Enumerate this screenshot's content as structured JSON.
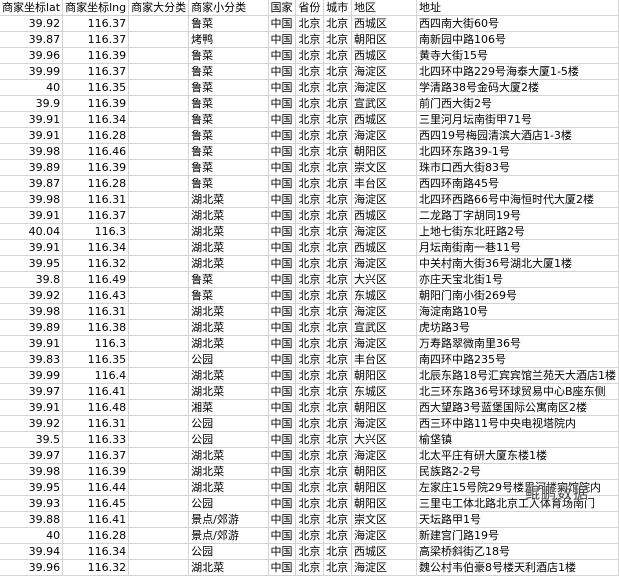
{
  "sheet": {
    "headers": [
      "商家坐标lat",
      "商家坐标lng",
      "商家大分类",
      "商家小分类",
      "国家",
      "省份",
      "城市",
      "地区",
      "地址"
    ],
    "rows": [
      [
        "39.92",
        "116.37",
        "",
        "鲁菜",
        "中国",
        "北京",
        "北京",
        "西城区",
        "西四南大街60号"
      ],
      [
        "39.87",
        "116.37",
        "",
        "烤鸭",
        "中国",
        "北京",
        "北京",
        "朝阳区",
        "南新园中路106号"
      ],
      [
        "39.96",
        "116.39",
        "",
        "鲁菜",
        "中国",
        "北京",
        "北京",
        "西城区",
        "黄寺大街15号"
      ],
      [
        "39.99",
        "116.37",
        "",
        "鲁菜",
        "中国",
        "北京",
        "北京",
        "海淀区",
        "北四环中路229号海泰大厦1-5楼"
      ],
      [
        "40",
        "116.35",
        "",
        "鲁菜",
        "中国",
        "北京",
        "北京",
        "海淀区",
        "学清路38号金码大厦2楼"
      ],
      [
        "39.9",
        "116.39",
        "",
        "鲁菜",
        "中国",
        "北京",
        "北京",
        "宣武区",
        "前门西大街2号"
      ],
      [
        "39.91",
        "116.34",
        "",
        "鲁菜",
        "中国",
        "北京",
        "北京",
        "西城区",
        "三里河月坛南街甲71号"
      ],
      [
        "39.91",
        "116.28",
        "",
        "鲁菜",
        "中国",
        "北京",
        "北京",
        "海淀区",
        "西四19号梅园清滨大酒店1-3楼"
      ],
      [
        "39.98",
        "116.46",
        "",
        "鲁菜",
        "中国",
        "北京",
        "北京",
        "朝阳区",
        "北四环东路39-1号"
      ],
      [
        "39.89",
        "116.39",
        "",
        "鲁菜",
        "中国",
        "北京",
        "北京",
        "崇文区",
        "珠市口西大街83号"
      ],
      [
        "39.87",
        "116.28",
        "",
        "鲁菜",
        "中国",
        "北京",
        "北京",
        "丰台区",
        "西四环南路45号"
      ],
      [
        "39.98",
        "116.31",
        "",
        "湖北菜",
        "中国",
        "北京",
        "北京",
        "海淀区",
        "北四环西路66号中海恒时代大厦2楼"
      ],
      [
        "39.91",
        "116.37",
        "",
        "湖北菜",
        "中国",
        "北京",
        "北京",
        "西城区",
        "二龙路丁字胡同19号"
      ],
      [
        "40.04",
        "116.3",
        "",
        "湖北菜",
        "中国",
        "北京",
        "北京",
        "海淀区",
        "上地七街东北旺路2号"
      ],
      [
        "39.91",
        "116.34",
        "",
        "湖北菜",
        "中国",
        "北京",
        "北京",
        "西城区",
        "月坛南街南一巷11号"
      ],
      [
        "39.95",
        "116.32",
        "",
        "湖北菜",
        "中国",
        "北京",
        "北京",
        "海淀区",
        "中关村南大街36号湖北大厦1楼"
      ],
      [
        "39.8",
        "116.49",
        "",
        "鲁菜",
        "中国",
        "北京",
        "北京",
        "大兴区",
        "亦庄天宝北街1号"
      ],
      [
        "39.92",
        "116.43",
        "",
        "鲁菜",
        "中国",
        "北京",
        "北京",
        "东城区",
        "朝阳门南小街269号"
      ],
      [
        "39.98",
        "116.31",
        "",
        "湖北菜",
        "中国",
        "北京",
        "北京",
        "海淀区",
        "海淀南路10号"
      ],
      [
        "39.89",
        "116.38",
        "",
        "湖北菜",
        "中国",
        "北京",
        "北京",
        "宣武区",
        "虎坊路3号"
      ],
      [
        "39.91",
        "116.3",
        "",
        "湖北菜",
        "中国",
        "北京",
        "北京",
        "海淀区",
        "万寿路翠微南里36号"
      ],
      [
        "39.83",
        "116.35",
        "",
        "公园",
        "中国",
        "北京",
        "北京",
        "丰台区",
        "南四环中路235号"
      ],
      [
        "39.99",
        "116.4",
        "",
        "湖北菜",
        "中国",
        "北京",
        "北京",
        "朝阳区",
        "北辰东路18号汇宾宾馆兰苑天大酒店1楼"
      ],
      [
        "39.97",
        "116.41",
        "",
        "湖北菜",
        "中国",
        "北京",
        "北京",
        "东城区",
        "北三环东路36号环球贸易中心B座东侧"
      ],
      [
        "39.91",
        "116.48",
        "",
        "湘菜",
        "中国",
        "北京",
        "北京",
        "朝阳区",
        "西大望路3号蓝堡国际公寓南区2楼"
      ],
      [
        "39.92",
        "116.31",
        "",
        "公园",
        "中国",
        "北京",
        "北京",
        "海淀区",
        "西三环中路11号中央电视塔院内"
      ],
      [
        "39.5",
        "116.33",
        "",
        "公园",
        "中国",
        "北京",
        "北京",
        "大兴区",
        "榆垡镇"
      ],
      [
        "39.97",
        "116.37",
        "",
        "湖北菜",
        "中国",
        "北京",
        "北京",
        "海淀区",
        "北太平庄有研大厦东楼1楼"
      ],
      [
        "39.98",
        "116.39",
        "",
        "湖北菜",
        "中国",
        "北京",
        "北京",
        "朝阳区",
        "民族路2-2号"
      ],
      [
        "39.95",
        "116.44",
        "",
        "湖北菜",
        "中国",
        "北京",
        "北京",
        "朝阳区",
        "左家庄15号院29号楼里河楼宾馆院内"
      ],
      [
        "39.93",
        "116.45",
        "",
        "公园",
        "中国",
        "北京",
        "北京",
        "朝阳区",
        "三里屯工体北路北京工人体育场南门"
      ],
      [
        "39.88",
        "116.41",
        "",
        "景点/郊游",
        "中国",
        "北京",
        "北京",
        "崇文区",
        "天坛路甲1号"
      ],
      [
        "40",
        "116.28",
        "",
        "景点/郊游",
        "中国",
        "北京",
        "北京",
        "海淀区",
        "新建宫门路19号"
      ],
      [
        "39.94",
        "116.34",
        "",
        "公园",
        "中国",
        "北京",
        "北京",
        "西城区",
        "高梁桥斜街乙18号"
      ],
      [
        "39.96",
        "116.32",
        "",
        "湖北菜",
        "中国",
        "北京",
        "北京",
        "海淀区",
        "魏公村韦伯豪8号楼天利酒店1楼"
      ]
    ]
  },
  "watermark": "鲲鹏数据"
}
